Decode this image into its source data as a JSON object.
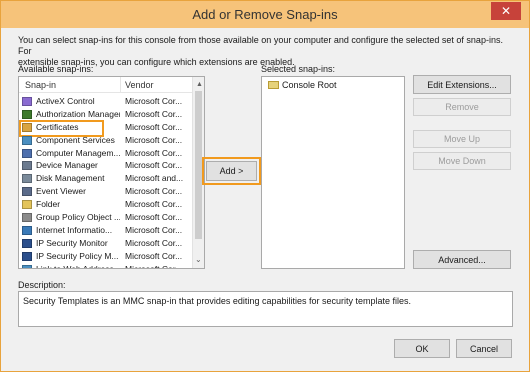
{
  "window": {
    "title": "Add or Remove Snap-ins",
    "close_glyph": "✕"
  },
  "intro": {
    "line1": "You can select snap-ins for this console from those available on your computer and configure the selected set of snap-ins. For",
    "line2": "extensible snap-ins, you can configure which extensions are enabled."
  },
  "available": {
    "label": "Available snap-ins:",
    "col_snapin": "Snap-in",
    "col_vendor": "Vendor",
    "rows": [
      {
        "name": "ActiveX Control",
        "vendor": "Microsoft Cor...",
        "icon": "activex-icon",
        "color": "#8a6bd1"
      },
      {
        "name": "Authorization Manager",
        "vendor": "Microsoft Cor...",
        "icon": "authorization-icon",
        "color": "#3d7a2c"
      },
      {
        "name": "Certificates",
        "vendor": "Microsoft Cor...",
        "icon": "certificate-icon",
        "color": "#d9a441"
      },
      {
        "name": "Component Services",
        "vendor": "Microsoft Cor...",
        "icon": "component-icon",
        "color": "#4a8fc1"
      },
      {
        "name": "Computer Managem...",
        "vendor": "Microsoft Cor...",
        "icon": "computer-management-icon",
        "color": "#4d6fae"
      },
      {
        "name": "Device Manager",
        "vendor": "Microsoft Cor...",
        "icon": "device-manager-icon",
        "color": "#6b7a8f"
      },
      {
        "name": "Disk Management",
        "vendor": "Microsoft and...",
        "icon": "disk-icon",
        "color": "#7a8a9a"
      },
      {
        "name": "Event Viewer",
        "vendor": "Microsoft Cor...",
        "icon": "event-viewer-icon",
        "color": "#5b6b8a"
      },
      {
        "name": "Folder",
        "vendor": "Microsoft Cor...",
        "icon": "folder-icon",
        "color": "#e3c45a"
      },
      {
        "name": "Group Policy Object ...",
        "vendor": "Microsoft Cor...",
        "icon": "group-policy-icon",
        "color": "#8b8b8b"
      },
      {
        "name": "Internet Informatio...",
        "vendor": "Microsoft Cor...",
        "icon": "iis-icon",
        "color": "#3a7ab8"
      },
      {
        "name": "IP Security Monitor",
        "vendor": "Microsoft Cor...",
        "icon": "ip-security-icon",
        "color": "#2b4f8c"
      },
      {
        "name": "IP Security Policy M...",
        "vendor": "Microsoft Cor...",
        "icon": "ip-policy-icon",
        "color": "#2b4f8c"
      },
      {
        "name": "Link to Web Address",
        "vendor": "Microsoft Cor...",
        "icon": "link-icon",
        "color": "#4a8fc1"
      }
    ],
    "highlighted": "Certificates"
  },
  "add_button": "Add >",
  "selected": {
    "label": "Selected snap-ins:",
    "items": [
      "Console Root"
    ]
  },
  "side_buttons": {
    "edit_extensions": "Edit Extensions...",
    "remove": "Remove",
    "move_up": "Move Up",
    "move_down": "Move Down",
    "advanced": "Advanced..."
  },
  "description": {
    "label": "Description:",
    "text": "Security Templates is an MMC snap-in that provides editing capabilities for security template files."
  },
  "footer": {
    "ok": "OK",
    "cancel": "Cancel"
  },
  "colors": {
    "title_bar": "#f6c37a",
    "close_button": "#c7423a",
    "highlight_outline": "#f19a1e"
  }
}
